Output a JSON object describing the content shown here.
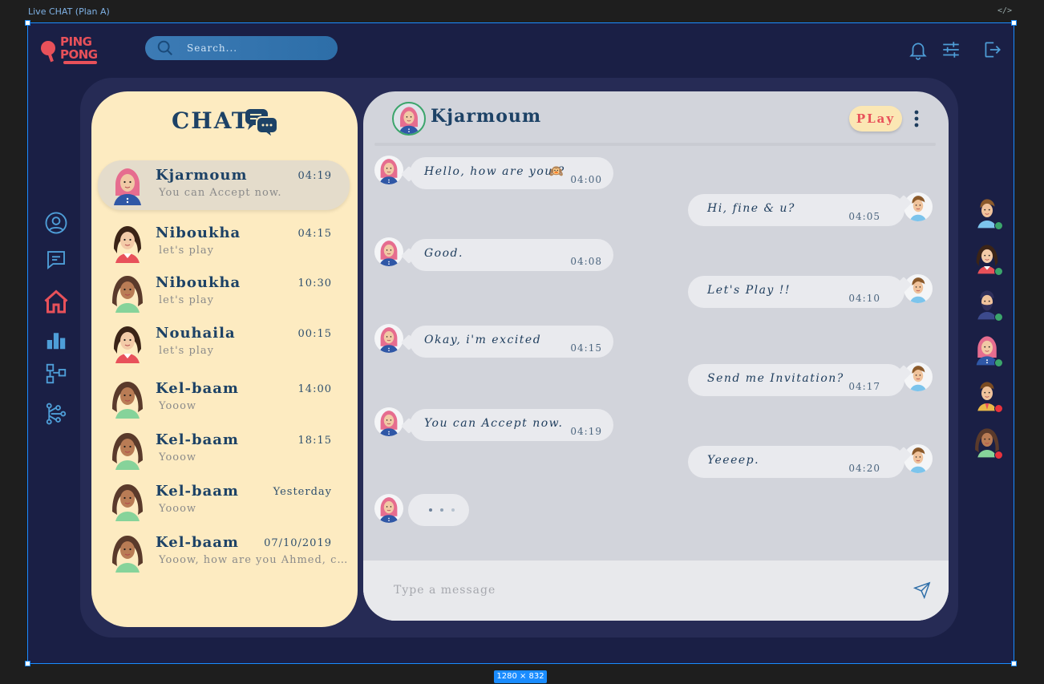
{
  "editor": {
    "frame_label": "Live CHAT (Plan A)",
    "code_icon": "</>",
    "size_badge": "1280 × 832"
  },
  "topbar": {
    "logo_line1": "PING",
    "logo_line2": "PONG",
    "search_placeholder": "Search...",
    "icons": [
      "bell-icon",
      "sliders-icon",
      "logout-icon"
    ]
  },
  "nav": {
    "icons": [
      "profile-icon",
      "chat-icon",
      "home-icon",
      "stats-icon",
      "tree-icon",
      "network-icon"
    ],
    "active": "home-icon"
  },
  "chat_list": {
    "title": "CHAT",
    "items": [
      {
        "name": "Kjarmoum",
        "time": "04:19",
        "preview": "You can Accept now.",
        "avatar": "hijab"
      },
      {
        "name": "Niboukha",
        "time": "04:15",
        "preview": "let's play",
        "avatar": "girl"
      },
      {
        "name": "Niboukha",
        "time": "10:30",
        "preview": "let's play",
        "avatar": "woman"
      },
      {
        "name": "Nouhaila",
        "time": "00:15",
        "preview": "let's play",
        "avatar": "girl"
      },
      {
        "name": "Kel-baam",
        "time": "14:00",
        "preview": "Yooow",
        "avatar": "woman"
      },
      {
        "name": "Kel-baam",
        "time": "18:15",
        "preview": "Yooow",
        "avatar": "woman"
      },
      {
        "name": "Kel-baam",
        "time": "Yesterday",
        "preview": "Yooow",
        "avatar": "woman"
      },
      {
        "name": "Kel-baam",
        "time": "07/10/2019",
        "preview": "Yooow, how are you Ahmed, co...",
        "avatar": "woman"
      }
    ]
  },
  "chat": {
    "contact_name": "Kjarmoum",
    "play_label": "PLay",
    "messages": [
      {
        "dir": "in",
        "text": "Hello, how are you ?",
        "time": "04:00",
        "emoji": true
      },
      {
        "dir": "out",
        "text": "Hi, fine & u?",
        "time": "04:05"
      },
      {
        "dir": "in",
        "text": "Good.",
        "time": "04:08"
      },
      {
        "dir": "out",
        "text": "Let's Play !!",
        "time": "04:10"
      },
      {
        "dir": "in",
        "text": "Okay, i'm excited",
        "time": "04:15"
      },
      {
        "dir": "out",
        "text": "Send me Invitation?",
        "time": "04:17"
      },
      {
        "dir": "in",
        "text": "You can Accept now.",
        "time": "04:19"
      },
      {
        "dir": "out",
        "text": "Yeeeep.",
        "time": "04:20"
      }
    ],
    "input_placeholder": "Type a message"
  },
  "online_users": [
    {
      "avatar": "man",
      "status": "online"
    },
    {
      "avatar": "girl",
      "status": "online"
    },
    {
      "avatar": "bearded",
      "status": "online"
    },
    {
      "avatar": "hijab",
      "status": "online"
    },
    {
      "avatar": "suit",
      "status": "offline"
    },
    {
      "avatar": "woman",
      "status": "offline"
    }
  ],
  "colors": {
    "background": "#1a1f45",
    "panel": "#262b55",
    "list_bg": "#fdebc1",
    "chat_bg": "#d2d4db",
    "accent_red": "#e8515a",
    "text_navy": "#1d4266",
    "online": "#3ba56b",
    "offline": "#e8323c"
  }
}
